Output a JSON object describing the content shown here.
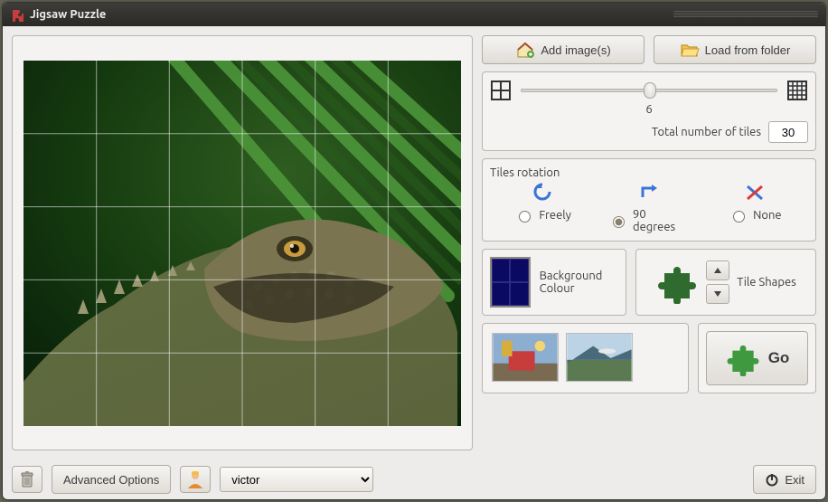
{
  "window": {
    "title": "Jigsaw Puzzle"
  },
  "top_buttons": {
    "add_images": "Add image(s)",
    "load_folder": "Load from folder"
  },
  "slider": {
    "value": "6",
    "total_label": "Total number of tiles",
    "total_value": "30"
  },
  "rotation": {
    "title": "Tiles rotation",
    "freely": "Freely",
    "ninety": "90 degrees",
    "none": "None",
    "selected": "ninety"
  },
  "background": {
    "label": "Background Colour",
    "color": "#0a0a63"
  },
  "tile_shapes": {
    "label": "Tile Shapes"
  },
  "go": {
    "label": "Go"
  },
  "bottom": {
    "advanced": "Advanced Options",
    "user": "victor",
    "exit": "Exit"
  }
}
